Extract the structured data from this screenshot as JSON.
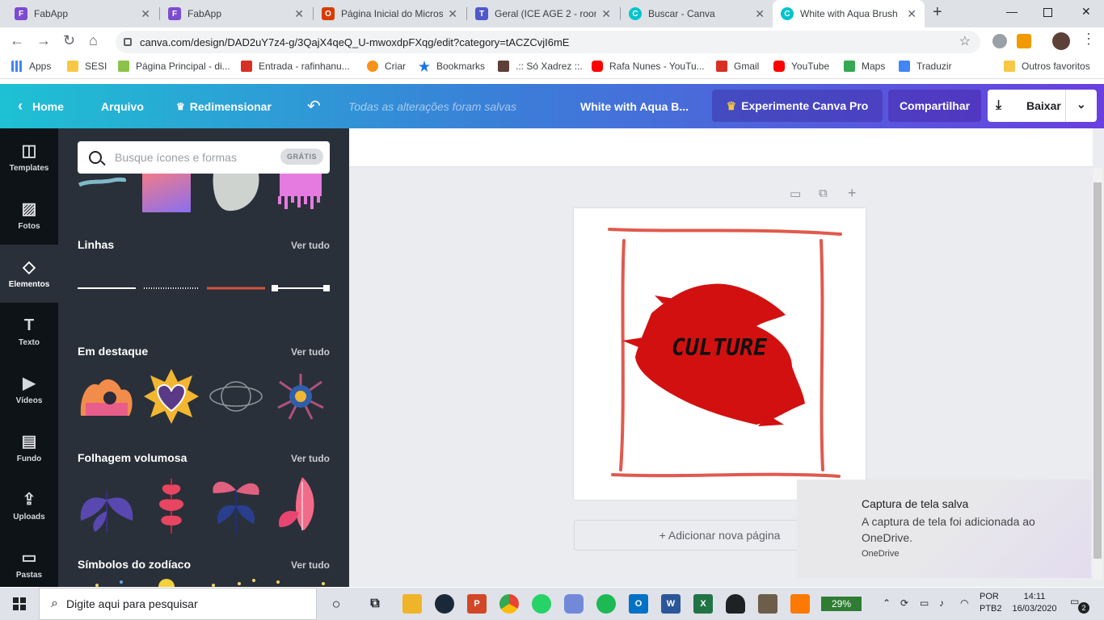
{
  "browser": {
    "tabs": [
      {
        "title": "FabApp",
        "icon": "fabapp-icon",
        "color": "#7b4bd1"
      },
      {
        "title": "FabApp",
        "icon": "fabapp-icon",
        "color": "#7b4bd1"
      },
      {
        "title": "Página Inicial do Micros",
        "icon": "office-icon",
        "color": "#d83b01"
      },
      {
        "title": "Geral (ICE AGE 2 - room",
        "icon": "teams-icon",
        "color": "#5059c9"
      },
      {
        "title": "Buscar - Canva",
        "icon": "canva-icon",
        "color": "#00c4cc"
      },
      {
        "title": "White with Aqua Brush",
        "icon": "canva-icon",
        "color": "#00c4cc"
      }
    ],
    "url": "canva.com/design/DAD2uY7z4-g/3QajX4qeQ_U-mwoxdpFXqg/edit?category=tACZCvjI6mE",
    "bookmarks": [
      {
        "label": "Apps",
        "icon": "apps-grid-icon",
        "color": "#4285f4"
      },
      {
        "label": "SESI",
        "icon": "folder-icon",
        "color": "#f6c843"
      },
      {
        "label": "Página Principal - di...",
        "icon": "page-icon",
        "color": "#8bc34a"
      },
      {
        "label": "Entrada - rafinhanu...",
        "icon": "gmail-icon",
        "color": "#d93025"
      },
      {
        "label": "Criar",
        "icon": "bitcoin-icon",
        "color": "#f7931a"
      },
      {
        "label": "Bookmarks",
        "icon": "star-icon",
        "color": "#1a73e8"
      },
      {
        "label": ".:: Só Xadrez ::.",
        "icon": "chess-icon",
        "color": "#5d4037"
      },
      {
        "label": "Rafa Nunes - YouTu...",
        "icon": "youtube-icon",
        "color": "#ff0000"
      },
      {
        "label": "Gmail",
        "icon": "gmail-icon",
        "color": "#d93025"
      },
      {
        "label": "YouTube",
        "icon": "youtube-icon",
        "color": "#ff0000"
      },
      {
        "label": "Maps",
        "icon": "maps-icon",
        "color": "#34a853"
      },
      {
        "label": "Traduzir",
        "icon": "translate-icon",
        "color": "#4285f4"
      },
      {
        "label": "Outros favoritos",
        "icon": "folder-icon",
        "color": "#f6c843"
      }
    ]
  },
  "canva": {
    "home": "Home",
    "file": "Arquivo",
    "resize": "Redimensionar",
    "saved": "Todas as alterações foram salvas",
    "doc_title": "White with Aqua B...",
    "pro": "Experimente Canva Pro",
    "share": "Compartilhar",
    "download": "Baixar",
    "accent": "#00c4cc"
  },
  "rail": [
    {
      "label": "Templates",
      "icon": "templates-icon",
      "glyph": "◫"
    },
    {
      "label": "Fotos",
      "icon": "photos-icon",
      "glyph": "▨"
    },
    {
      "label": "Elementos",
      "icon": "elements-icon",
      "glyph": "◇"
    },
    {
      "label": "Texto",
      "icon": "text-icon",
      "glyph": "T"
    },
    {
      "label": "Vídeos",
      "icon": "video-icon",
      "glyph": "▶"
    },
    {
      "label": "Fundo",
      "icon": "background-icon",
      "glyph": "▤"
    },
    {
      "label": "Uploads",
      "icon": "upload-icon",
      "glyph": "⇪"
    },
    {
      "label": "Pastas",
      "icon": "folder-icon",
      "glyph": "▭"
    }
  ],
  "panel": {
    "search_placeholder": "Busque ícones e formas",
    "search_badge": "GRÁTIS",
    "sections": [
      {
        "title": "Linhas",
        "see_all": "Ver tudo"
      },
      {
        "title": "Em destaque",
        "see_all": "Ver tudo"
      },
      {
        "title": "Folhagem volumosa",
        "see_all": "Ver tudo"
      },
      {
        "title": "Símbolos do zodíaco",
        "see_all": "Ver tudo"
      }
    ]
  },
  "design": {
    "text": "CULTURE",
    "brush_color": "#d21010",
    "frame_color": "#e05a4e"
  },
  "add_page": "+ Adicionar nova página",
  "toast": {
    "title": "Captura de tela salva",
    "message": "A captura de tela foi adicionada ao OneDrive.",
    "app": "OneDrive"
  },
  "taskbar": {
    "search": "Digite aqui para pesquisar",
    "battery": "29%",
    "lang": "POR",
    "layout": "PTB2",
    "time": "14:11",
    "date": "16/03/2020",
    "notifications": "2",
    "apps": [
      {
        "icon": "task-view-icon",
        "color": "#202124"
      },
      {
        "icon": "file-explorer-icon",
        "color": "#f0b429"
      },
      {
        "icon": "steam-icon",
        "color": "#1b2838"
      },
      {
        "icon": "powerpoint-icon",
        "color": "#d24726"
      },
      {
        "icon": "chrome-icon",
        "color": "#4285f4"
      },
      {
        "icon": "whatsapp-icon",
        "color": "#25d366"
      },
      {
        "icon": "discord-icon",
        "color": "#7289da"
      },
      {
        "icon": "spotify-icon",
        "color": "#1db954"
      },
      {
        "icon": "outlook-icon",
        "color": "#0072c6"
      },
      {
        "icon": "word-icon",
        "color": "#2b579a"
      },
      {
        "icon": "excel-icon",
        "color": "#217346"
      },
      {
        "icon": "people-icon",
        "color": "#202124"
      },
      {
        "icon": "gimp-icon",
        "color": "#6d5d4b"
      },
      {
        "icon": "avast-icon",
        "color": "#ff7800"
      }
    ]
  }
}
